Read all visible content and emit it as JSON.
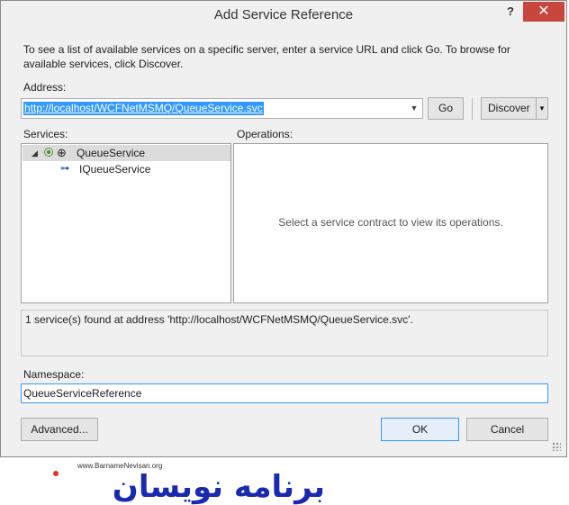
{
  "window": {
    "title": "Add Service Reference",
    "help_glyph": "?",
    "close_glyph": "✕"
  },
  "intro_text": "To see a list of available services on a specific server, enter a service URL and click Go. To browse for available services, click Discover.",
  "address": {
    "label": "Address:",
    "value": "http://localhost/WCFNetMSMQ/QueueService.svc",
    "go_label": "Go",
    "discover_label": "Discover"
  },
  "services": {
    "label": "Services:",
    "items": [
      {
        "label": "QueueService",
        "icon": "globe-icon",
        "expanded": true,
        "selected": true
      },
      {
        "label": "IQueueService",
        "icon": "interface-icon",
        "expanded": false,
        "selected": false
      }
    ]
  },
  "operations": {
    "label": "Operations:",
    "placeholder": "Select a service contract to view its operations."
  },
  "status_text": "1 service(s) found at address 'http://localhost/WCFNetMSMQ/QueueService.svc'.",
  "namespace": {
    "label": "Namespace:",
    "value": "QueueServiceReference"
  },
  "buttons": {
    "advanced": "Advanced...",
    "ok": "OK",
    "cancel": "Cancel"
  },
  "watermark": {
    "url": "www.BarnameNevisan.org",
    "logo_text": "برنامه نویسان",
    "color": "#1a2ab0"
  }
}
